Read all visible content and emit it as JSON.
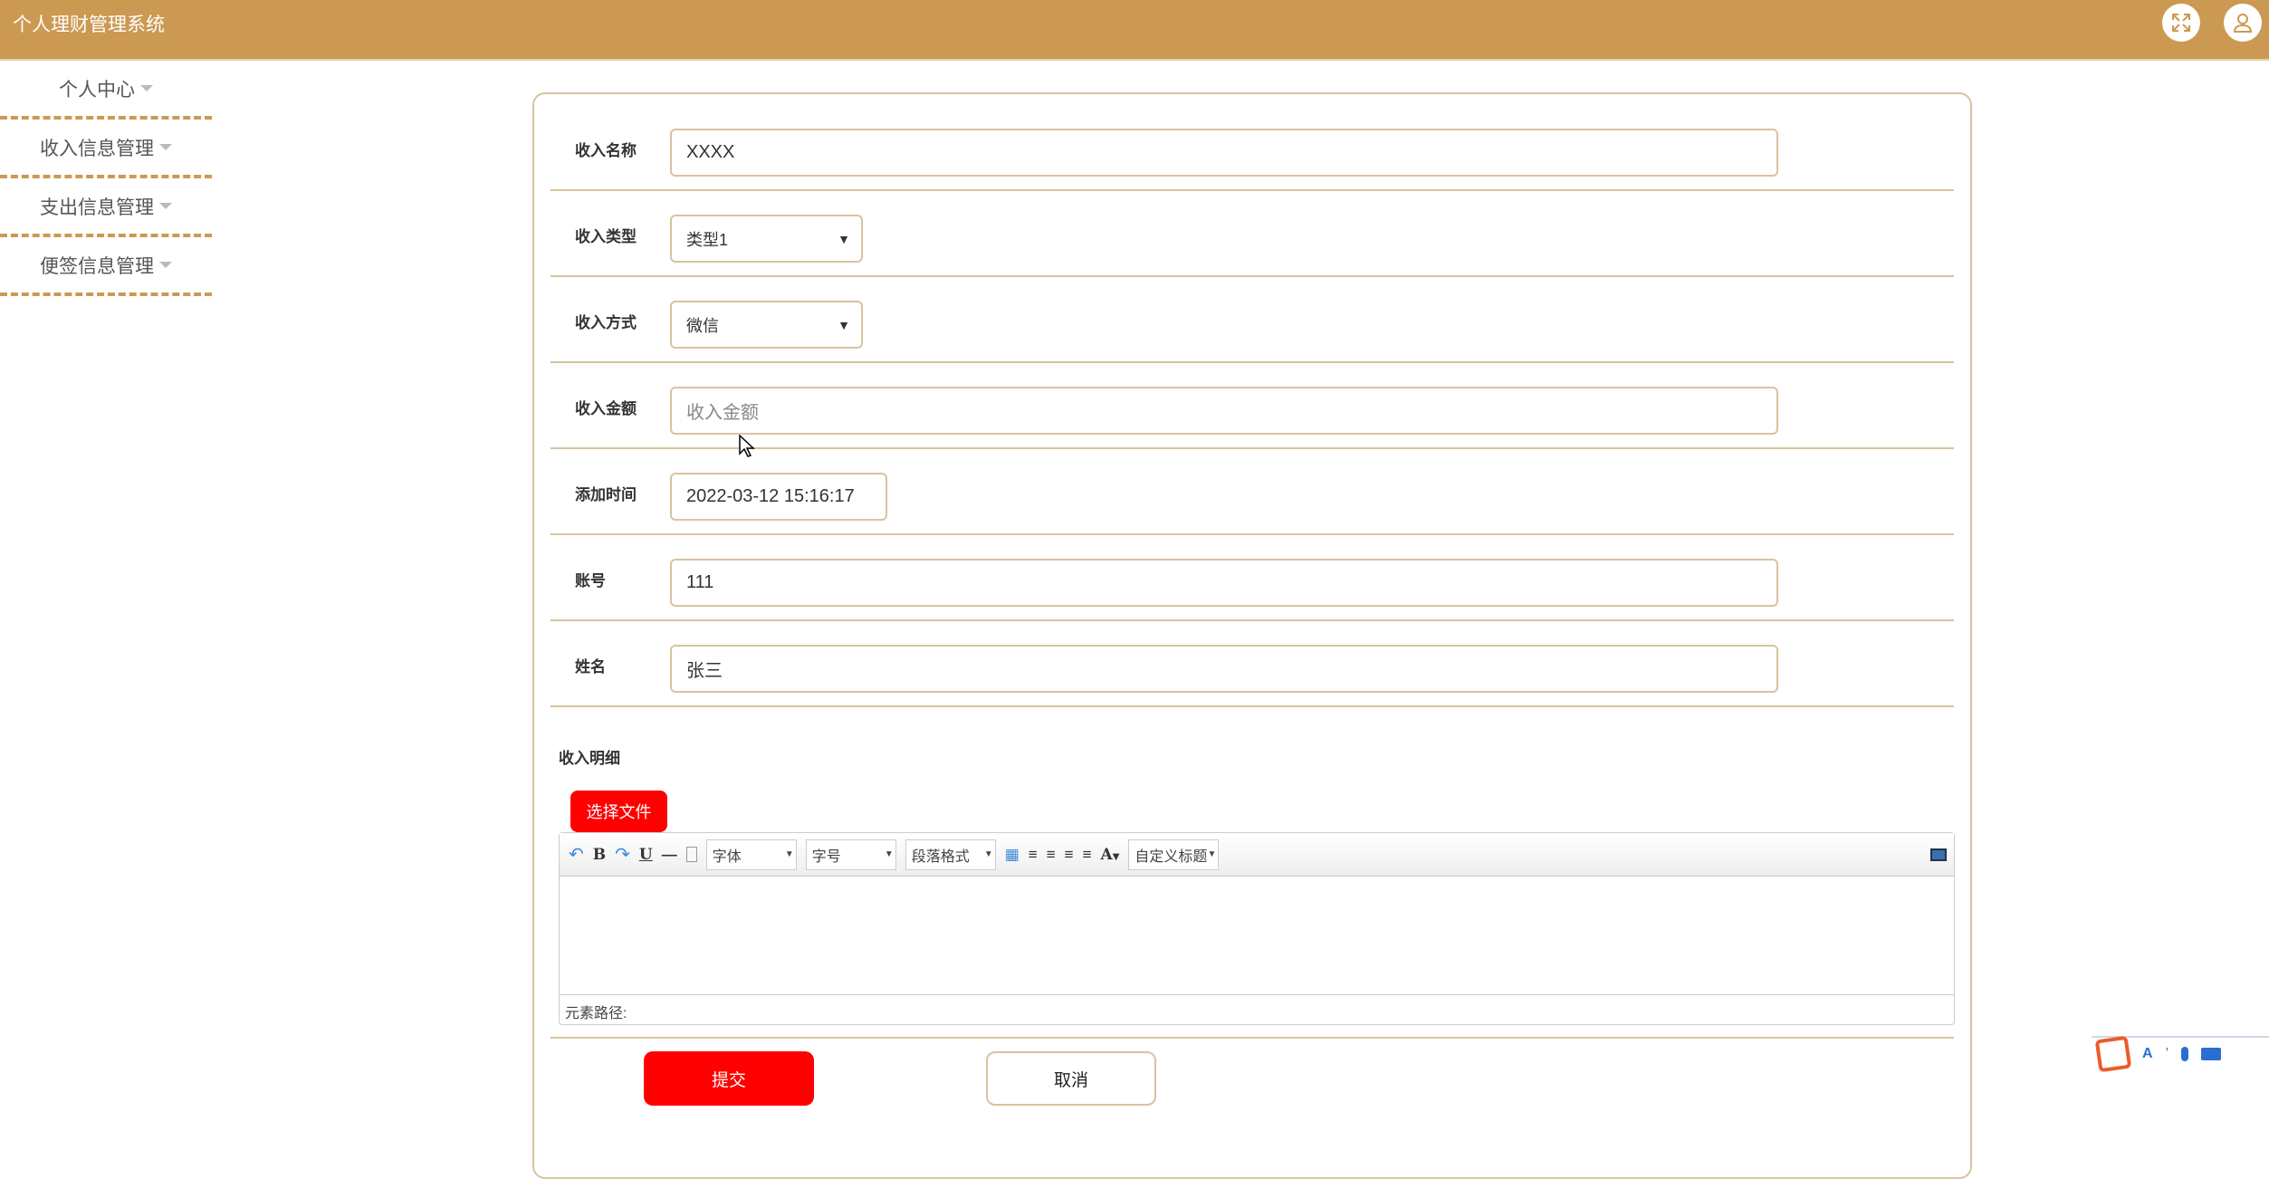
{
  "header": {
    "title": "个人理财管理系统"
  },
  "sidebar": {
    "items": [
      {
        "label": "个人中心"
      },
      {
        "label": "收入信息管理"
      },
      {
        "label": "支出信息管理"
      },
      {
        "label": "便签信息管理"
      }
    ]
  },
  "form": {
    "income_name": {
      "label": "收入名称",
      "value": "XXXX"
    },
    "income_type": {
      "label": "收入类型",
      "value": "类型1"
    },
    "income_method": {
      "label": "收入方式",
      "value": "微信"
    },
    "income_amount": {
      "label": "收入金额",
      "placeholder": "收入金额"
    },
    "add_time": {
      "label": "添加时间",
      "value": "2022-03-12 15:16:17"
    },
    "account": {
      "label": "账号",
      "value": "111"
    },
    "name": {
      "label": "姓名",
      "value": "张三"
    },
    "detail": {
      "label": "收入明细",
      "file_button": "选择文件"
    },
    "editor": {
      "font": "字体",
      "size": "字号",
      "paragraph": "段落格式",
      "custom_title": "自定义标题",
      "bold": "B",
      "underline": "U",
      "font_color": "A",
      "status": "元素路径:"
    },
    "submit": "提交",
    "cancel": "取消"
  }
}
